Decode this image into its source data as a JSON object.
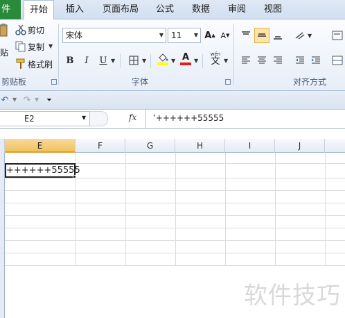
{
  "tabs": [
    {
      "label": "件",
      "file": true
    },
    {
      "label": "开始",
      "active": true
    },
    {
      "label": "插入"
    },
    {
      "label": "页面布局"
    },
    {
      "label": "公式"
    },
    {
      "label": "数据"
    },
    {
      "label": "审阅"
    },
    {
      "label": "视图"
    }
  ],
  "clipboard": {
    "paste": "贴",
    "cut": "剪切",
    "copy": "复制",
    "format_painter": "格式刷",
    "group_label": "剪贴板"
  },
  "font": {
    "name": "宋体",
    "size": "11",
    "grow": "A",
    "shrink": "A",
    "bold": "B",
    "italic": "I",
    "underline": "U",
    "font_color_letter": "A",
    "phonetic": "文",
    "phonetic_top": "wén",
    "group_label": "字体",
    "fill_color": "#ffff00",
    "text_color": "#e02020"
  },
  "alignment": {
    "group_label": "对齐方式"
  },
  "formula_bar": {
    "name_box": "E2",
    "fx": "fx",
    "content": "’++++++55555"
  },
  "columns": [
    "E",
    "F",
    "G",
    "H",
    "I",
    "J"
  ],
  "selected_column": "E",
  "active_cell": {
    "ref": "E2",
    "value": "++++++55555"
  },
  "watermark": "软件技巧",
  "colors": {
    "file_tab": "#2a8a3c",
    "selection_header": "#f1c15f",
    "align_highlight": "#fbe4a6"
  }
}
